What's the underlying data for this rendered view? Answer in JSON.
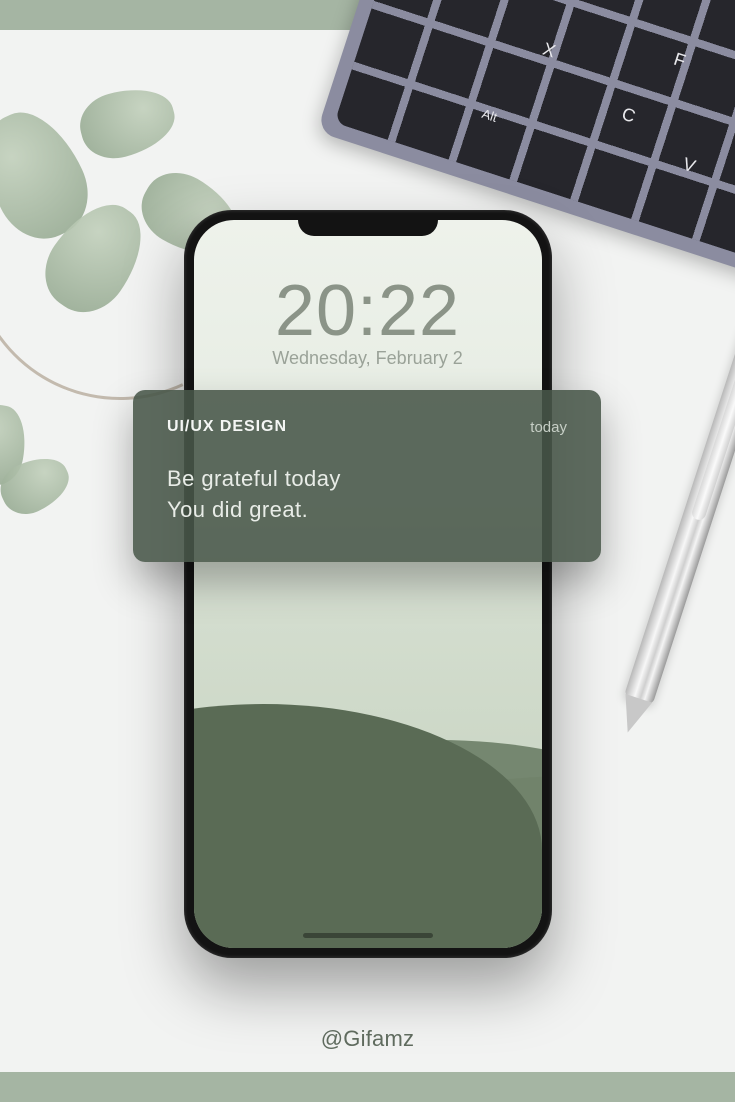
{
  "keyboard": {
    "keys": {
      "x": "X",
      "f": "F",
      "c": "C",
      "v": "V",
      "alt": "Alt"
    }
  },
  "lockscreen": {
    "time": "20:22",
    "date": "Wednesday, February 2"
  },
  "notification": {
    "app": "UI/UX DESIGN",
    "when": "today",
    "line1": "Be grateful today",
    "line2": "You did great."
  },
  "footer": {
    "handle": "@Gifamz"
  },
  "colors": {
    "bar": "#a5b5a3",
    "notif_bg": "rgba(72,86,73,.88)"
  }
}
